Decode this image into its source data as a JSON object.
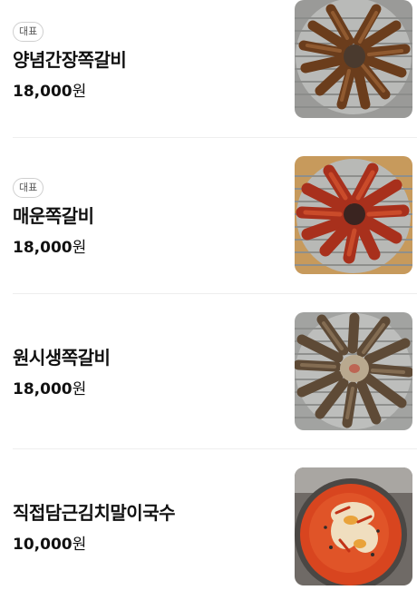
{
  "menu": {
    "items": [
      {
        "badge": "대표",
        "name": "양념간장쪽갈비",
        "price": "18,000",
        "unit": "원"
      },
      {
        "badge": "대표",
        "name": "매운쪽갈비",
        "price": "18,000",
        "unit": "원"
      },
      {
        "badge": "",
        "name": "원시생쪽갈비",
        "price": "18,000",
        "unit": "원"
      },
      {
        "badge": "",
        "name": "직접담근김치말이국수",
        "price": "10,000",
        "unit": "원"
      }
    ]
  }
}
